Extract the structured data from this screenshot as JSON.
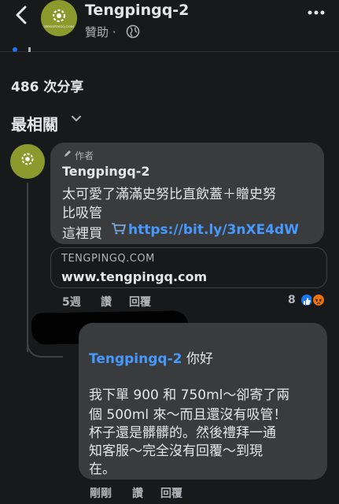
{
  "header": {
    "back_icon": "chevron-left-icon",
    "page_name": "Tengpingq-2",
    "sponsored": "贊助 ·",
    "privacy_icon": "globe-icon",
    "more_icon": "more-dots-icon",
    "logo_text": "TENGPINGQ.COM"
  },
  "post": {
    "shares": "486 次分享",
    "sort_label": "最相關",
    "sort_icon": "chevron-down-icon"
  },
  "comment1": {
    "author_badge": "作者",
    "author": "Tengpingq-2",
    "line1": "太可愛了滿滿史努比直飲蓋＋贈史努",
    "line2": "比吸管",
    "line3_prefix": "這裡買",
    "cart_icon": "shopping-cart-icon",
    "link": "https://bit.ly/3nXE4dW",
    "preview_domain": "TENGPINGQ.COM",
    "preview_url": "www.tengpingq.com",
    "time": "5週",
    "like": "讚",
    "reply": "回覆",
    "reaction_count": "8",
    "reaction_icons": [
      "like-icon",
      "angry-icon"
    ]
  },
  "comment2": {
    "mention": "Tengpingq-2",
    "greeting": " 你好",
    "line1": "我下單 900 和 750ml～卻寄了兩",
    "line2": "個 500ml 來～而且還沒有吸管！",
    "line3": "杯子還是髒髒的。然後禮拜一通",
    "line4": "知客服～完全沒有回覆～到現",
    "line5": "在。",
    "time": "剛剛",
    "like": "讚",
    "reply": "回覆"
  },
  "colors": {
    "background": "#18191a",
    "bubble": "#3a3b3c",
    "link": "#4599ff",
    "logo": "#8a9a2c",
    "secondary_text": "#b0b3b8"
  }
}
